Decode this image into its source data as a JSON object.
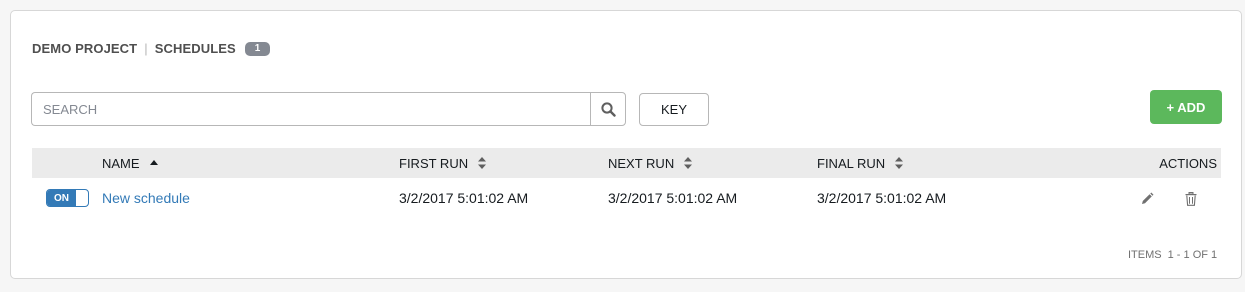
{
  "header": {
    "project": "DEMO PROJECT",
    "separator": "|",
    "section": "SCHEDULES",
    "count": "1"
  },
  "search": {
    "placeholder": "SEARCH",
    "value": "",
    "icon": "search-icon"
  },
  "toolbar": {
    "key_label": "KEY",
    "add_label": "+ ADD"
  },
  "table": {
    "columns": [
      {
        "label": "NAME",
        "sort": "ascending"
      },
      {
        "label": "FIRST RUN",
        "sort": "unsorted"
      },
      {
        "label": "NEXT RUN",
        "sort": "unsorted"
      },
      {
        "label": "FINAL RUN",
        "sort": "unsorted"
      },
      {
        "label": "ACTIONS",
        "sort": "none"
      }
    ],
    "rows": [
      {
        "toggle": "ON",
        "name": "New schedule",
        "first_run": "3/2/2017 5:01:02 AM",
        "next_run": "3/2/2017 5:01:02 AM",
        "final_run": "3/2/2017 5:01:02 AM",
        "actions": [
          "pencil-icon",
          "trash-icon"
        ]
      }
    ]
  },
  "pagination": {
    "label": "ITEMS",
    "range": "1 - 1 OF 1"
  },
  "colors": {
    "accent": "#337ab7",
    "add_button": "#5cb85c",
    "badge": "#848992",
    "header_bg": "#ebebeb"
  }
}
